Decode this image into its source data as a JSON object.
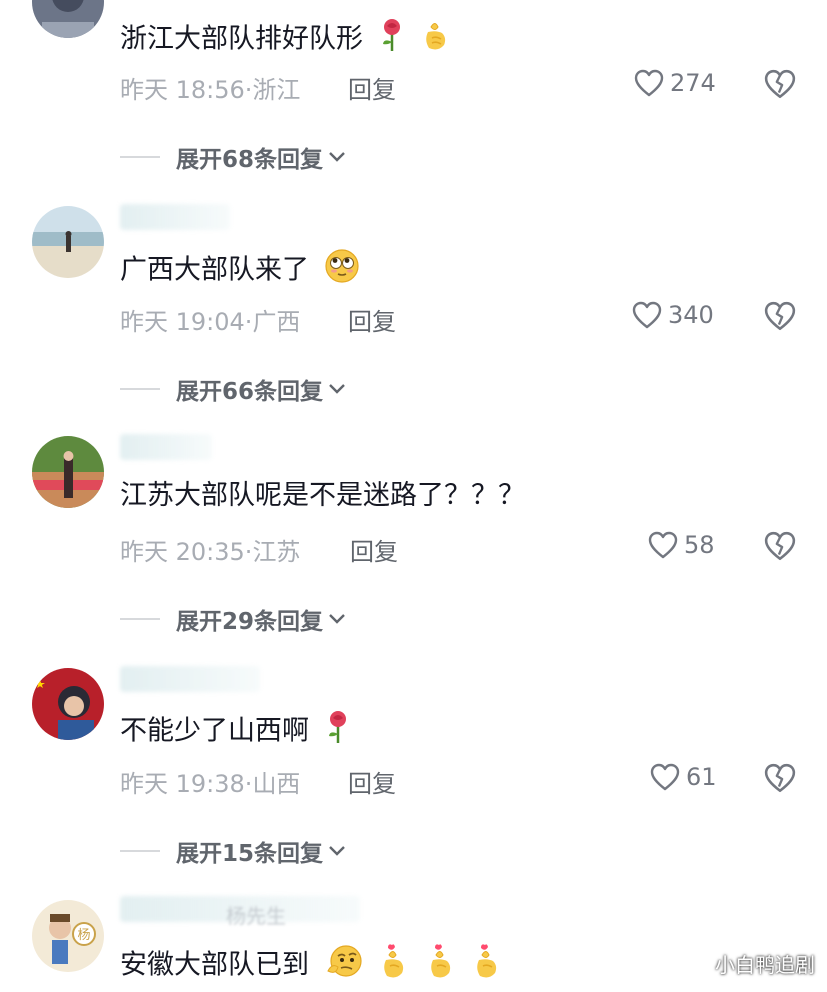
{
  "comments": [
    {
      "text": "浙江大部队排好队形",
      "time": "昨天 18:56",
      "location": "浙江",
      "reply_label": "回复",
      "likes": "274",
      "expand_label": "展开68条回复"
    },
    {
      "text": "广西大部队来了",
      "time": "昨天 19:04",
      "location": "广西",
      "reply_label": "回复",
      "likes": "340",
      "expand_label": "展开66条回复"
    },
    {
      "text": "江苏大部队呢是不是迷路了？？？",
      "time": "昨天 20:35",
      "location": "江苏",
      "reply_label": "回复",
      "likes": "58",
      "expand_label": "展开29条回复"
    },
    {
      "text": "不能少了山西啊",
      "time": "昨天 19:38",
      "location": "山西",
      "reply_label": "回复",
      "likes": "61",
      "expand_label": "展开15条回复"
    },
    {
      "username": "杨先生",
      "text": "安徽大部队已到"
    }
  ],
  "icons": {
    "like": "heart-outline-icon",
    "dislike": "broken-heart-icon",
    "expand": "chevron-down-icon"
  },
  "watermark": "小白鸭追剧"
}
